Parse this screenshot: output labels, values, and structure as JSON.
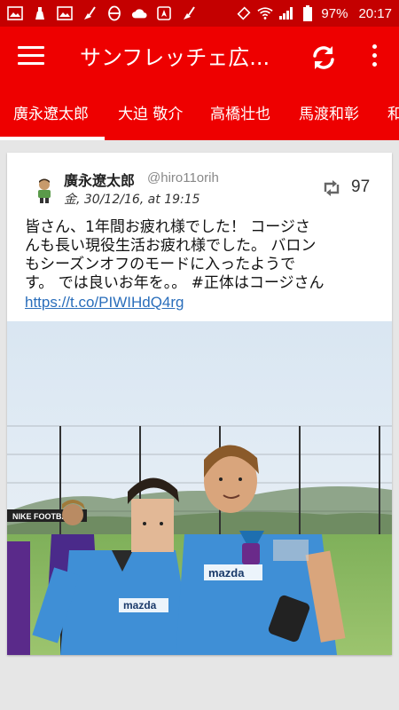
{
  "status_bar": {
    "battery": "97%",
    "time": "20:17"
  },
  "app_bar": {
    "title": "サンフレッチェ広..."
  },
  "tabs": [
    {
      "label": "廣永遼太郎"
    },
    {
      "label": "大迫 敬介"
    },
    {
      "label": "高橋壮也"
    },
    {
      "label": "馬渡和彰"
    },
    {
      "label": "和"
    }
  ],
  "tweet": {
    "author": "廣永遼太郎",
    "handle": "@hiro11orih",
    "date": "金, 30/12/16, at 19:15",
    "retweet_count": "97",
    "text_lines": [
      "皆さん、1年間お疲れ様でした！ コージさ",
      "んも長い現役生活お疲れ様でした。 バロン",
      "もシーズンオフのモードに入ったようで",
      "す。 では良いお年を。。 #正体はコージさん"
    ],
    "link": "https://t.co/PIWIHdQ4rg",
    "photo_banner": "NIKE FOOTBALL",
    "jersey_sponsor": "mazda"
  },
  "colors": {
    "status_bar": "#c40000",
    "app_bar": "#ee0000",
    "link": "#2a6ebb"
  }
}
